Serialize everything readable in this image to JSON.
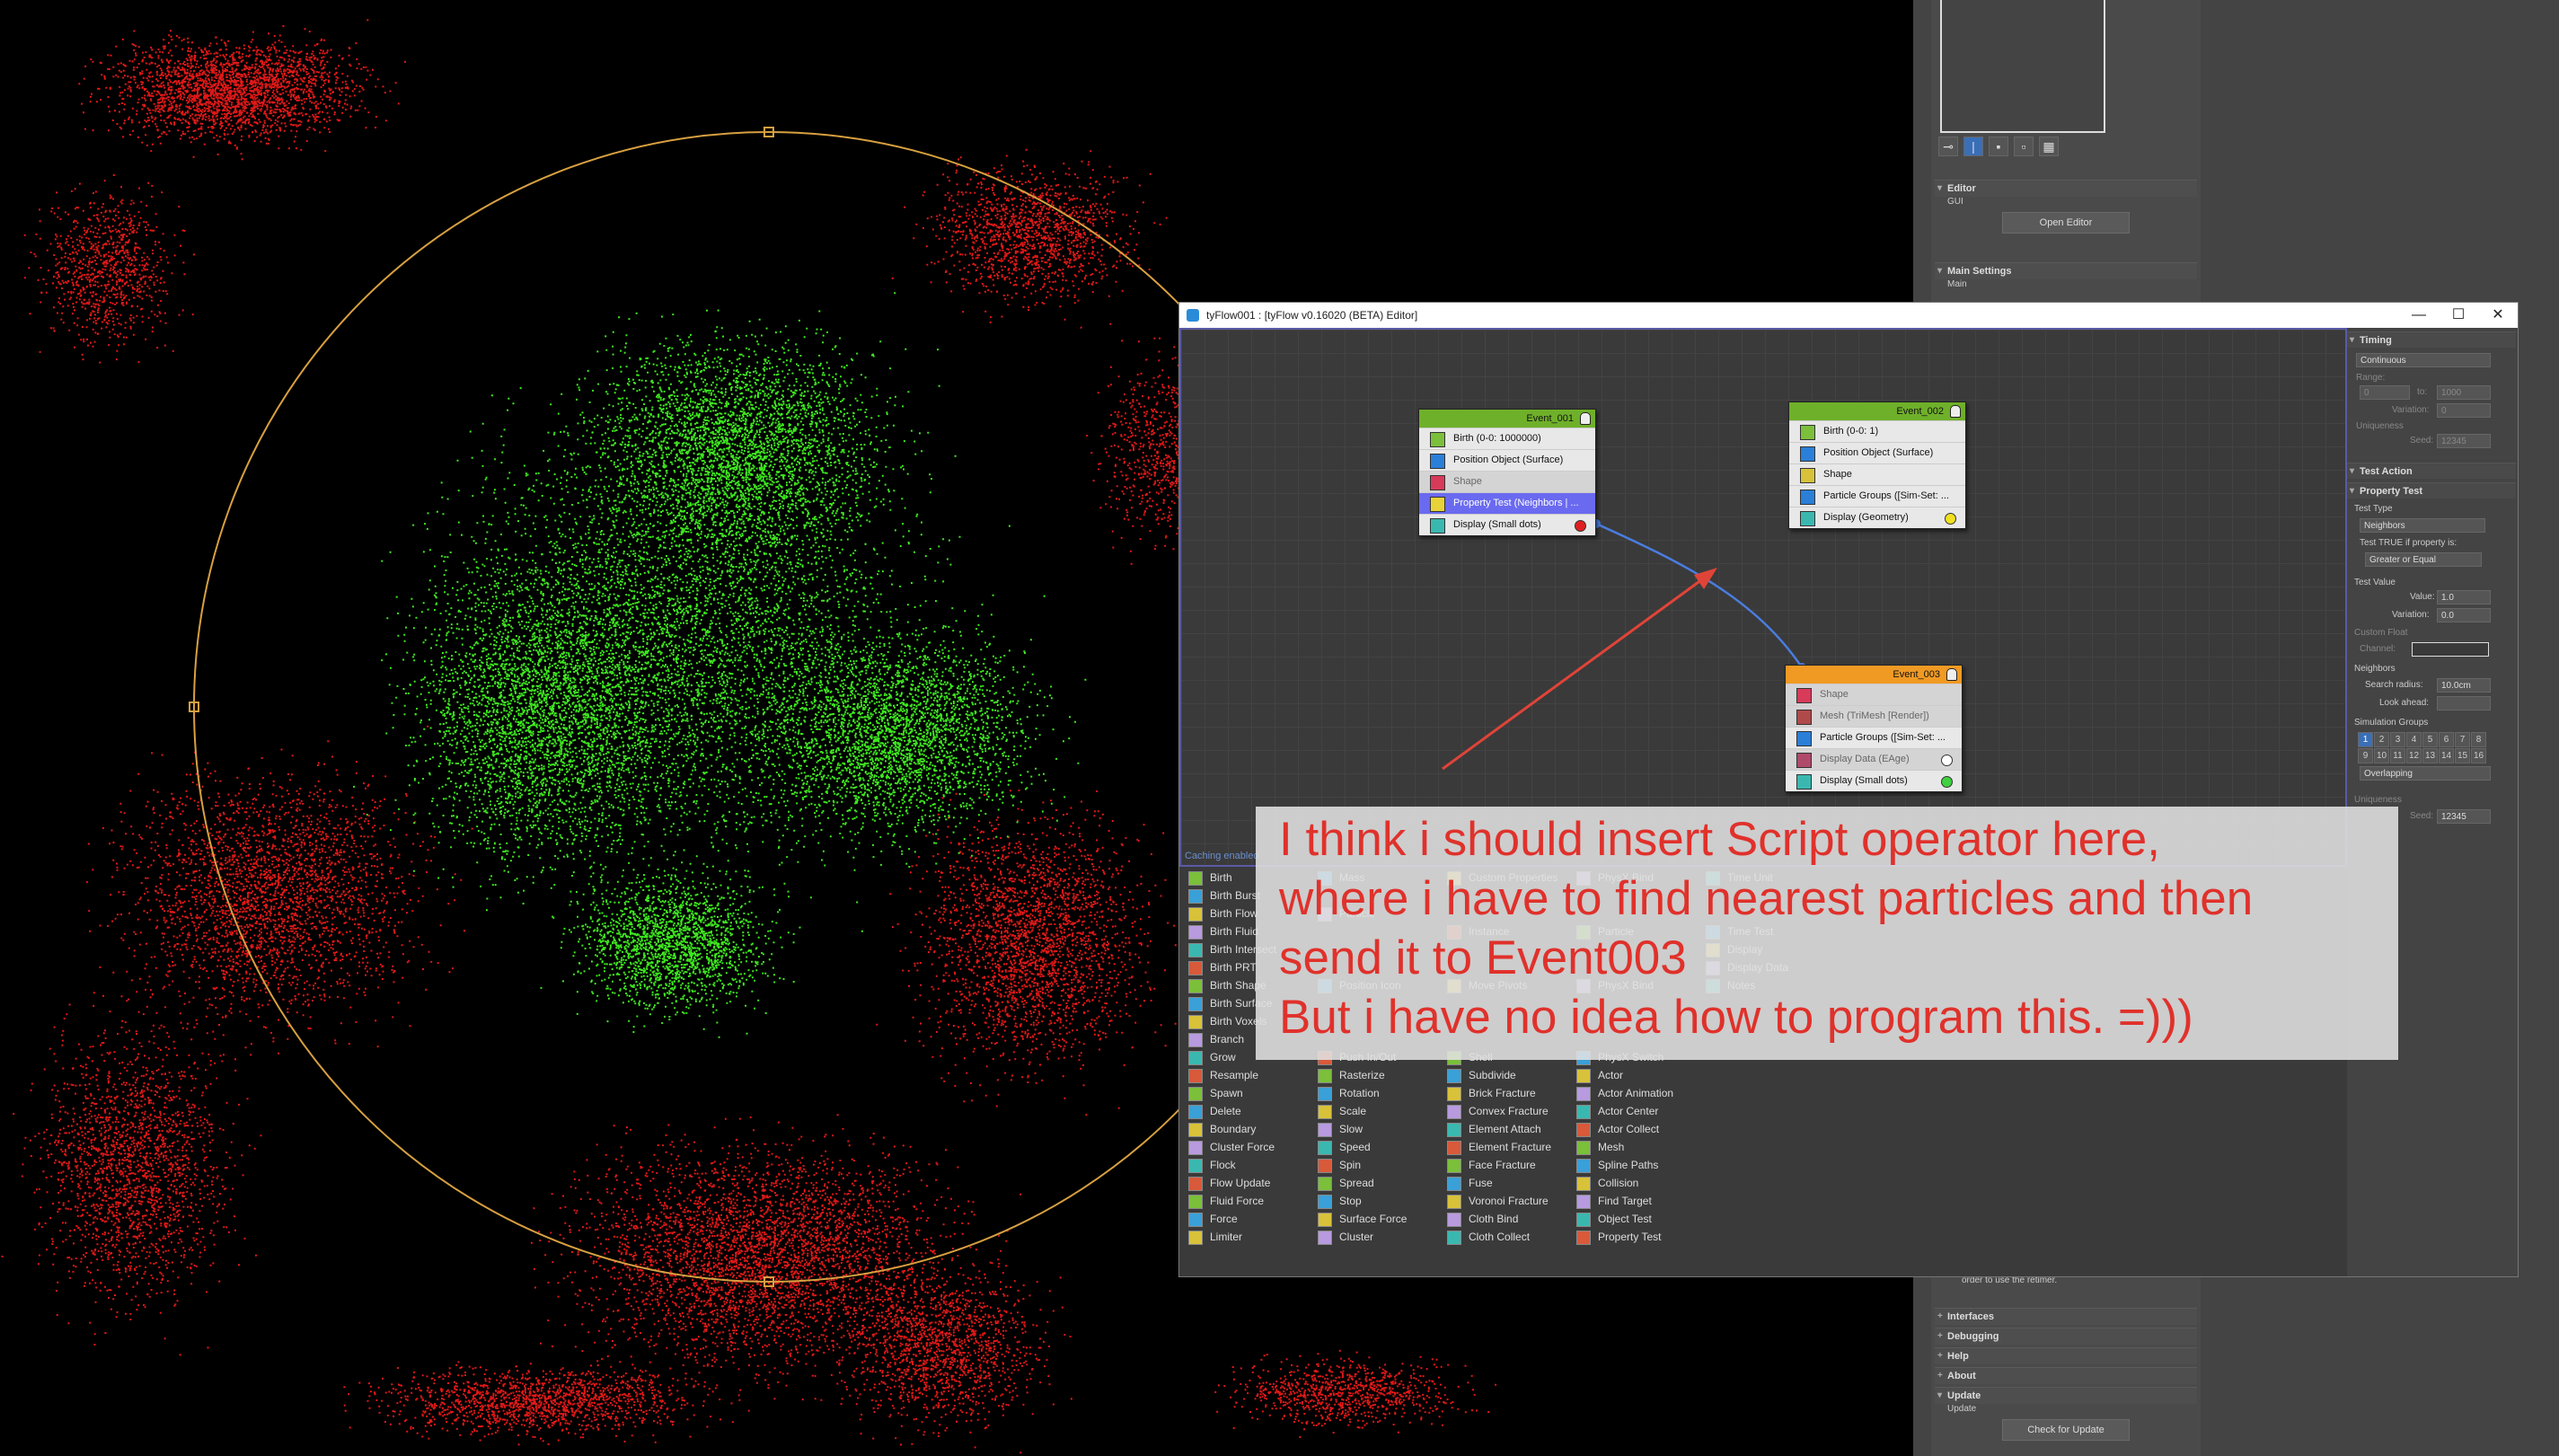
{
  "command_panel": {
    "editor": {
      "title": "Editor",
      "gui_label": "GUI",
      "open_editor_label": "Open Editor"
    },
    "main_settings": {
      "title": "Main Settings",
      "main_label": "Main"
    },
    "retimer_note": "order to use the retimer.",
    "rollouts": [
      "Interfaces",
      "Debugging",
      "Help",
      "About"
    ],
    "update": {
      "title": "Update",
      "update_label": "Update",
      "check_button": "Check for Update"
    }
  },
  "editor_window": {
    "title": "tyFlow001 : [tyFlow v0.16020 (BETA) Editor]",
    "controls": {
      "minimize": "—",
      "maximize": "☐",
      "close": "✕"
    },
    "caching_text": "Caching enabled",
    "events": [
      {
        "name": "Event_001",
        "color": "#6fb02a",
        "operators": [
          {
            "label": "Birth (0-0: 1000000)",
            "icon": "birth-icon",
            "state": "normal"
          },
          {
            "label": "Position Object (Surface)",
            "icon": "position-object-icon",
            "state": "normal"
          },
          {
            "label": "Shape",
            "icon": "shape-icon",
            "state": "dim"
          },
          {
            "label": "Property Test (Neighbors | ...",
            "icon": "property-test-icon",
            "state": "selected"
          },
          {
            "label": "Display (Small dots)",
            "icon": "display-icon",
            "state": "normal",
            "dot": "#e02020"
          }
        ]
      },
      {
        "name": "Event_002",
        "color": "#6fb02a",
        "operators": [
          {
            "label": "Birth (0-0: 1)",
            "icon": "birth-icon",
            "state": "normal"
          },
          {
            "label": "Position Object (Surface)",
            "icon": "position-object-icon",
            "state": "normal"
          },
          {
            "label": "Shape",
            "icon": "shape-icon",
            "state": "normal"
          },
          {
            "label": "Particle Groups ([Sim-Set: ...",
            "icon": "particle-groups-icon",
            "state": "normal"
          },
          {
            "label": "Display (Geometry)",
            "icon": "display-icon",
            "state": "normal",
            "dot": "#f0e020"
          }
        ]
      },
      {
        "name": "Event_003",
        "color": "#f09a24",
        "operators": [
          {
            "label": "Shape",
            "icon": "shape-icon",
            "state": "dim"
          },
          {
            "label": "Mesh (TriMesh [Render])",
            "icon": "mesh-icon",
            "state": "dim"
          },
          {
            "label": "Particle Groups ([Sim-Set: ...",
            "icon": "particle-groups-icon",
            "state": "normal"
          },
          {
            "label": "Display Data (EAge)",
            "icon": "display-data-icon",
            "state": "dim",
            "dot": "#ffffff"
          },
          {
            "label": "Display (Small dots)",
            "icon": "display-icon",
            "state": "normal",
            "dot": "#40d040"
          }
        ]
      }
    ],
    "depot": {
      "columns": [
        [
          "Birth",
          "Birth Burst",
          "Birth Flow",
          "Birth Fluid",
          "Birth Intersect",
          "Birth PRT",
          "Birth Shape",
          "Birth Surface",
          "Birth Voxels",
          "Branch",
          "Grow",
          "Resample",
          "Spawn",
          "Delete",
          "Boundary",
          "Cluster Force",
          "Flock",
          "Flow Update",
          "Fluid Force",
          "Force",
          "Limiter"
        ],
        [
          "Mass",
          "",
          "Particle",
          "",
          "",
          "",
          "Position Icon",
          "",
          "",
          "",
          "Push In/Out",
          "Rasterize",
          "Rotation",
          "Scale",
          "Slow",
          "Speed",
          "Spin",
          "Spread",
          "Stop",
          "Surface Force",
          "Cluster"
        ],
        [
          "Custom Properties",
          "",
          "",
          "Instance",
          "",
          "",
          "Move Pivots",
          "",
          "",
          "",
          "Shell",
          "Subdivide",
          "Brick Fracture",
          "Convex Fracture",
          "Element Attach",
          "Element Fracture",
          "Face Fracture",
          "Fuse",
          "Voronoi Fracture",
          "Cloth Bind",
          "Cloth Collect"
        ],
        [
          "PhysX Bind",
          "",
          "",
          "Particle",
          "",
          "",
          "PhysX Bind",
          "",
          "",
          "",
          "PhysX Switch",
          "Actor",
          "Actor Animation",
          "Actor Center",
          "Actor Collect",
          "Mesh",
          "Spline Paths",
          "Collision",
          "Find Target",
          "Object Test",
          "Property Test"
        ],
        [
          "Time Unit",
          "",
          "",
          "Time Test",
          "Display",
          "Display Data",
          "Notes",
          "",
          "",
          "",
          "",
          "",
          "",
          "",
          "",
          "",
          "",
          "",
          "",
          "",
          ""
        ]
      ]
    },
    "properties": {
      "timing": {
        "title": "Timing",
        "mode": "Continuous",
        "range_label": "Range:",
        "range_from": "0",
        "range_to_label": "to:",
        "range_to": "1000",
        "variation_label": "Variation:",
        "variation": "0",
        "uniqueness_label": "Uniqueness",
        "seed_label": "Seed:",
        "seed": "12345"
      },
      "test_action_title": "Test Action",
      "property_test": {
        "title": "Property Test",
        "test_type_label": "Test Type",
        "test_type": "Neighbors",
        "true_if_label": "Test TRUE if property is:",
        "comparison": "Greater or Equal",
        "test_value_label": "Test Value",
        "value_label": "Value:",
        "value": "1.0",
        "variation_label": "Variation:",
        "variation": "0.0",
        "custom_float_label": "Custom Float",
        "channel_label": "Channel:",
        "neighbors_label": "Neighbors",
        "search_radius_label": "Search radius:",
        "search_radius": "10.0cm",
        "look_ahead_label": "Look ahead:",
        "sim_groups_label": "Simulation Groups",
        "sim_groups": [
          "1",
          "2",
          "3",
          "4",
          "5",
          "6",
          "7",
          "8",
          "9",
          "10",
          "11",
          "12",
          "13",
          "14",
          "15",
          "16"
        ],
        "sim_groups_on": [
          "1"
        ],
        "overlap_mode": "Overlapping",
        "uniqueness_label": "Uniqueness",
        "seed_label": "Seed:",
        "seed": "12345"
      }
    }
  },
  "annotation": {
    "lines": [
      "I think i should insert Script operator here,",
      "where i have to find nearest particles and then",
      "send it to Event003",
      "But i have no idea how to program this. =)))"
    ],
    "color": "#e0312b"
  }
}
